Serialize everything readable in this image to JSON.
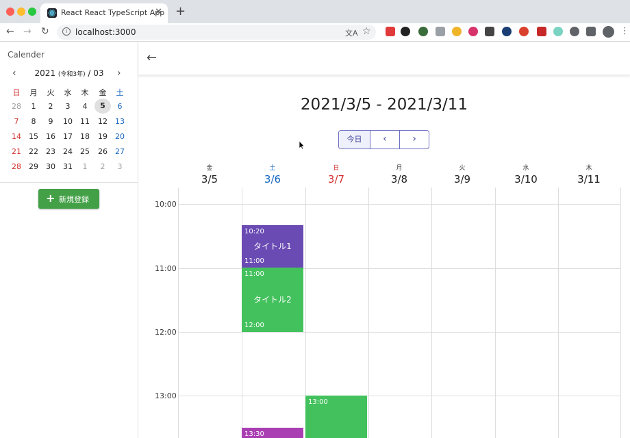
{
  "browser": {
    "tab_title": "React React TypeScript App",
    "tab_close": "✕",
    "new_tab": "+",
    "url": "localhost:3000",
    "extensions": [
      "#e03a3a",
      "#222222",
      "#3a6b3a",
      "#9aa0a6",
      "#f0b429",
      "#d6336c",
      "#444444",
      "#1a3e73",
      "#d9412c",
      "#c62828",
      "#7ad3c1",
      "#5f6368",
      "#5f6368"
    ]
  },
  "sidebar": {
    "title": "Calender",
    "month_year": "2021",
    "month_era": "(令和3年)",
    "month_num": "/ 03",
    "weekdays": [
      "日",
      "月",
      "火",
      "水",
      "木",
      "金",
      "土"
    ],
    "weeks": [
      [
        "28",
        "1",
        "2",
        "3",
        "4",
        "5",
        "6"
      ],
      [
        "7",
        "8",
        "9",
        "10",
        "11",
        "12",
        "13"
      ],
      [
        "14",
        "15",
        "16",
        "17",
        "18",
        "19",
        "20"
      ],
      [
        "21",
        "22",
        "23",
        "24",
        "25",
        "26",
        "27"
      ],
      [
        "28",
        "29",
        "30",
        "31",
        "1",
        "2",
        "3"
      ]
    ],
    "today": "5",
    "new_button": "新規登録"
  },
  "header": {
    "range_title": "2021/3/5 - 2021/3/11",
    "today_button": "今日"
  },
  "week": {
    "columns": [
      {
        "dow": "金",
        "date": "3/5"
      },
      {
        "dow": "土",
        "date": "3/6"
      },
      {
        "dow": "日",
        "date": "3/7"
      },
      {
        "dow": "月",
        "date": "3/8"
      },
      {
        "dow": "火",
        "date": "3/9"
      },
      {
        "dow": "水",
        "date": "3/10"
      },
      {
        "dow": "木",
        "date": "3/11"
      }
    ],
    "times": [
      "10:00",
      "11:00",
      "12:00",
      "13:00"
    ],
    "events": [
      {
        "start": "10:20",
        "end": "11:00",
        "title": "タイトル1",
        "color": "#6a4bb4"
      },
      {
        "start": "11:00",
        "end": "12:00",
        "title": "タイトル2",
        "color": "#43c15d"
      },
      {
        "start": "13:00",
        "end": "",
        "title": "",
        "color": "#43c15d"
      },
      {
        "start": "13:30",
        "end": "",
        "title": "",
        "color": "#a93fb3"
      }
    ]
  },
  "colors": {
    "sunday": "#d32f2f",
    "saturday": "#1565c0",
    "primary_button": "#43a047"
  }
}
